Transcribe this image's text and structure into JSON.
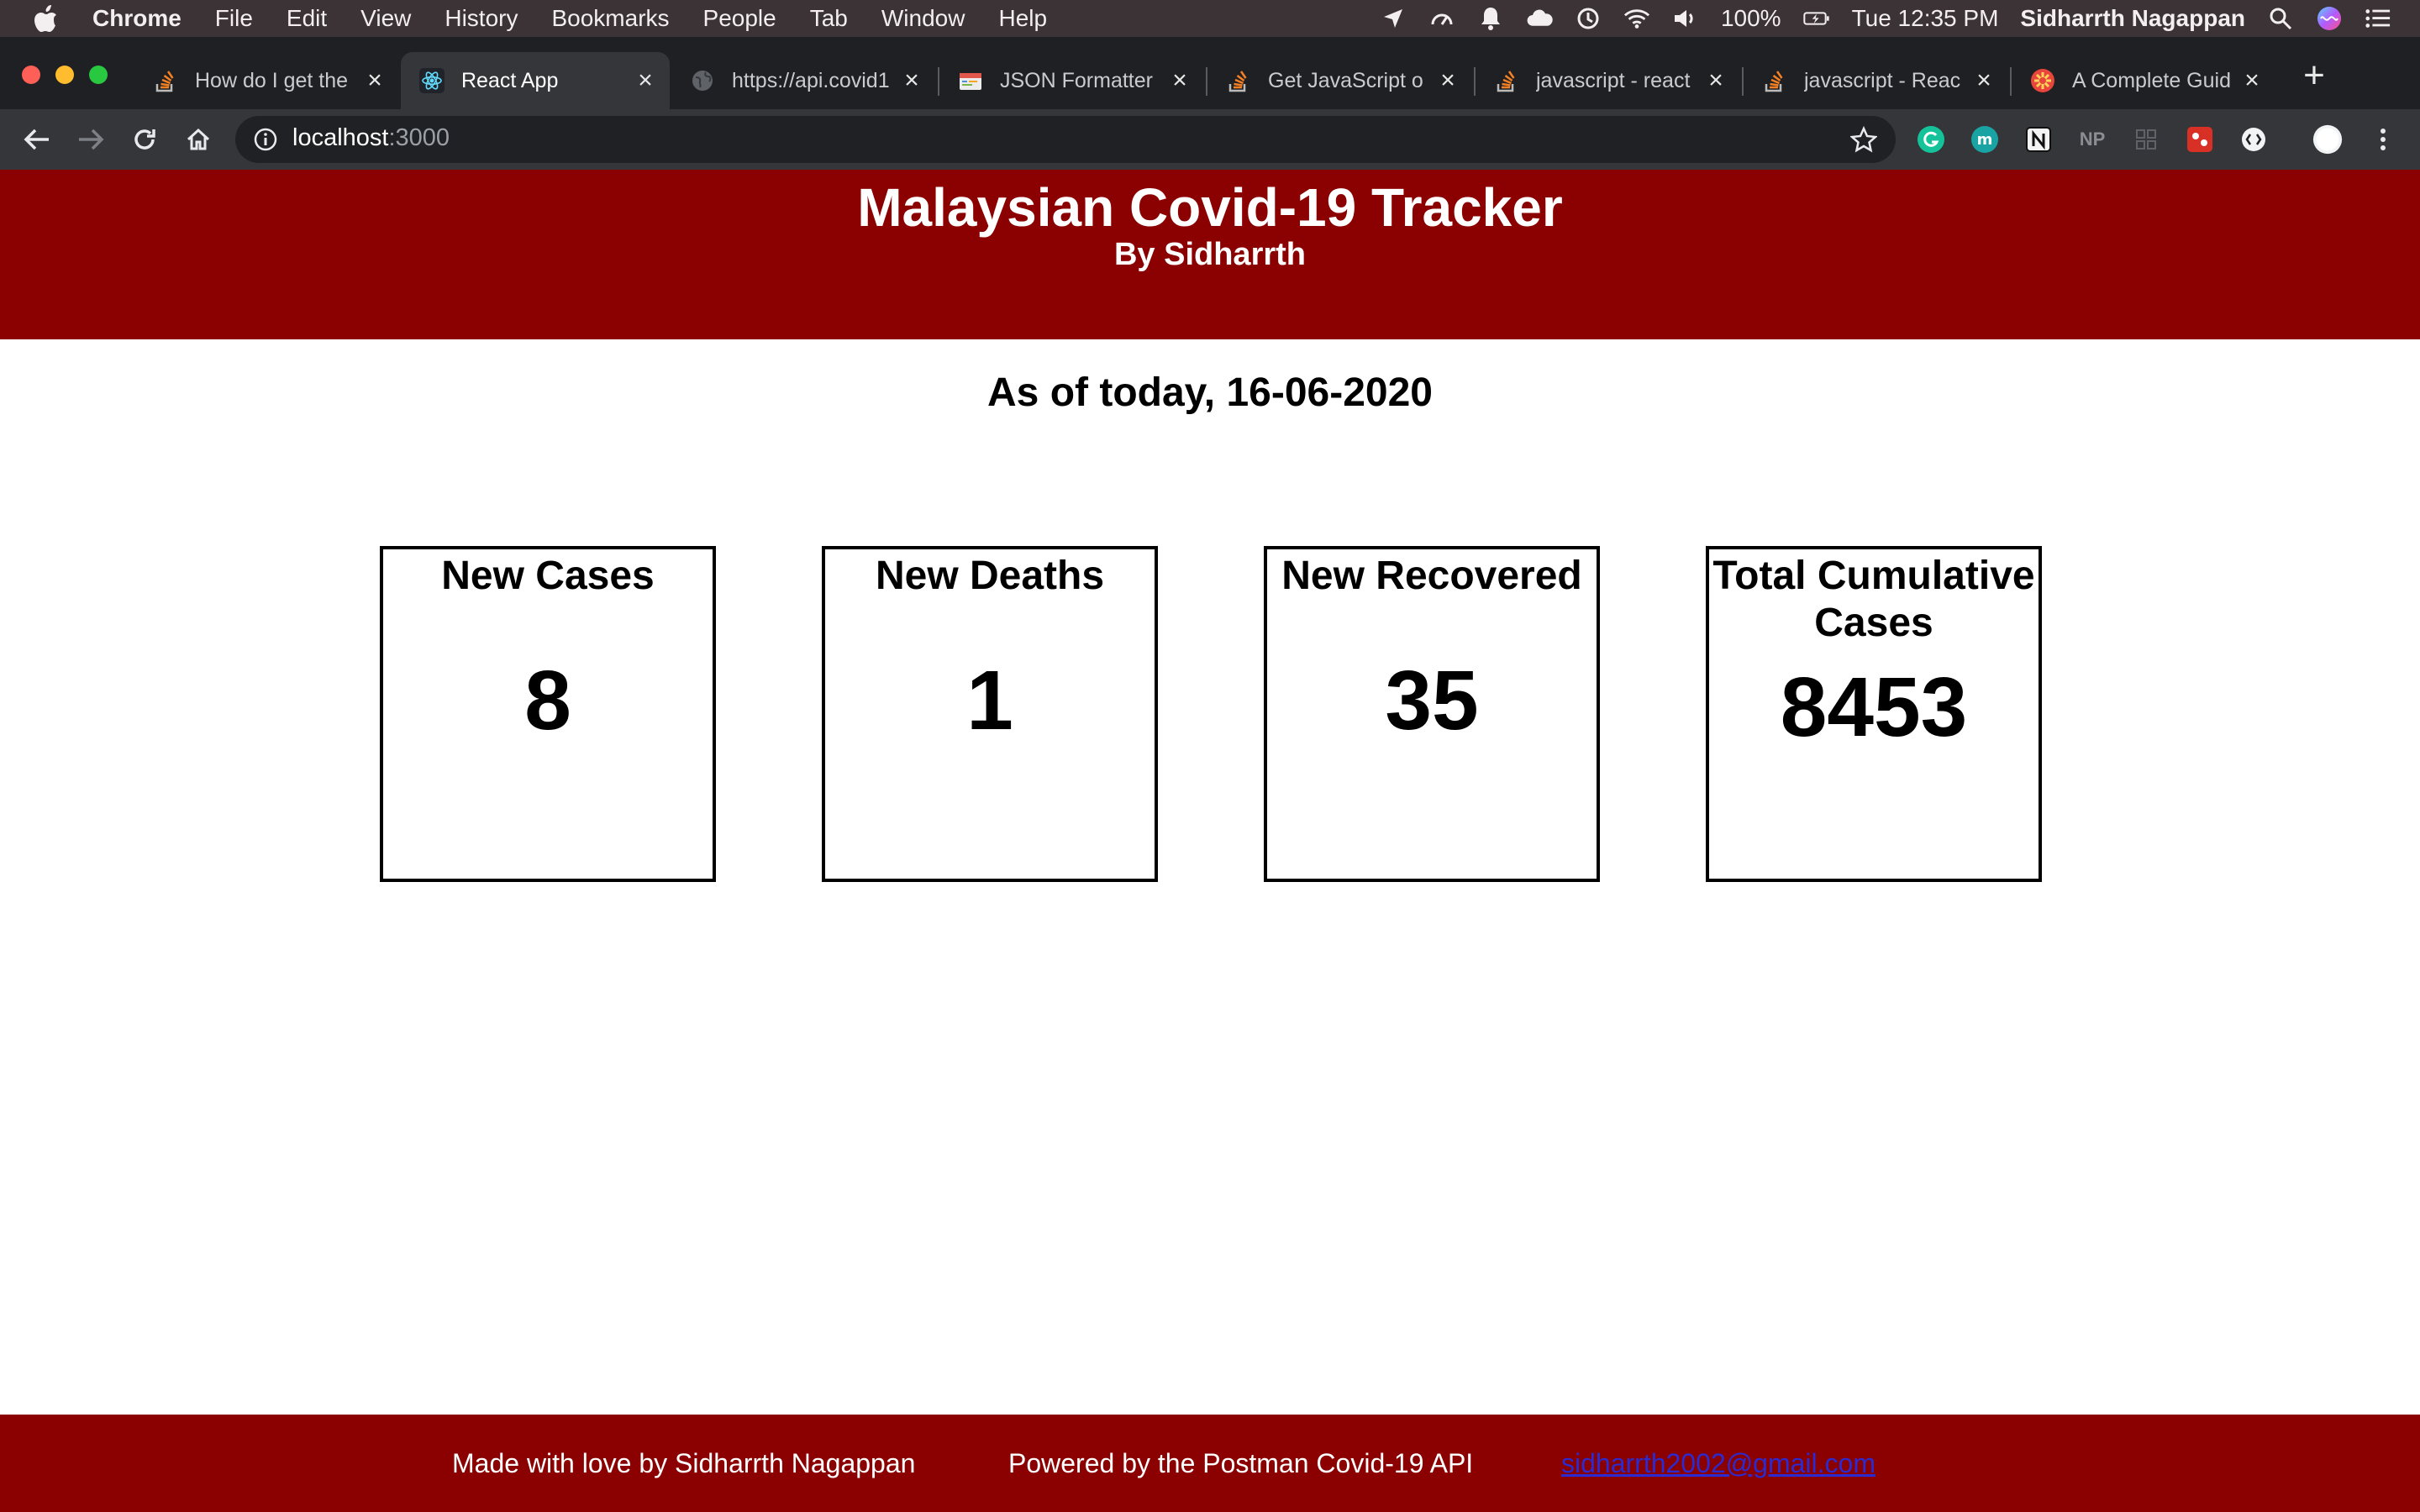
{
  "menubar": {
    "app_name": "Chrome",
    "items": [
      "File",
      "Edit",
      "View",
      "History",
      "Bookmarks",
      "People",
      "Tab",
      "Window",
      "Help"
    ],
    "battery": "100%",
    "clock": "Tue 12:35 PM",
    "user": "Sidharrth Nagappan"
  },
  "tabs": [
    {
      "title": "How do I get the",
      "icon": "stackoverflow-icon"
    },
    {
      "title": "React App",
      "icon": "react-icon"
    },
    {
      "title": "https://api.covid1",
      "icon": "globe-icon"
    },
    {
      "title": "JSON Formatter",
      "icon": "json-formatter-icon"
    },
    {
      "title": "Get JavaScript o",
      "icon": "stackoverflow-icon"
    },
    {
      "title": "javascript - react",
      "icon": "stackoverflow-icon"
    },
    {
      "title": "javascript - Reac",
      "icon": "stackoverflow-icon"
    },
    {
      "title": "A Complete Guid",
      "icon": "guide-icon"
    }
  ],
  "active_tab": 1,
  "address_bar": {
    "host": "localhost",
    "port": ":3000"
  },
  "extensions": {
    "np_label": "NP"
  },
  "page": {
    "title": "Malaysian Covid-19 Tracker",
    "subtitle": "By Sidharrth",
    "as_of": "As of today, 16-06-2020",
    "cards": [
      {
        "label": "New Cases",
        "value": "8"
      },
      {
        "label": "New Deaths",
        "value": "1"
      },
      {
        "label": "New Recovered",
        "value": "35"
      },
      {
        "label": "Total Cumulative Cases",
        "value": "8453"
      }
    ]
  },
  "footer": {
    "credit": "Made with love by Sidharrth Nagappan",
    "powered_by": "Powered by the Postman Covid-19 API",
    "email": "sidharrth2002@gmail.com"
  },
  "colors": {
    "header_bg": "#8b0000",
    "footer_bg": "#8b0000",
    "menubar_bg": "#3b3336",
    "tabstrip_bg": "#1f2023",
    "toolbar_bg": "#35363a"
  }
}
